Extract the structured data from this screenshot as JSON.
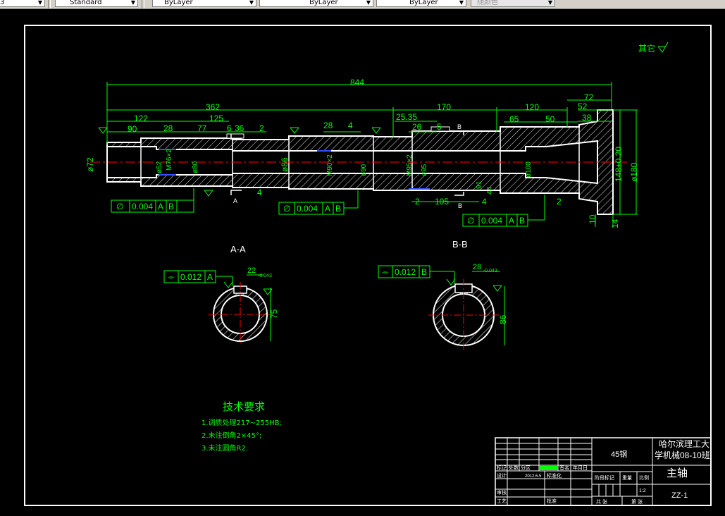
{
  "toolbar": {
    "dim_style": "3",
    "text_style": "Standard",
    "layer": "ByLayer",
    "linetype": "ByLayer",
    "lineweight": "ByLayer",
    "color": "随颜色"
  },
  "drawing": {
    "dims": {
      "d844": "844",
      "d362": "362",
      "d170": "170",
      "d120": "120",
      "d72": "72",
      "d52": "52",
      "d38": "38",
      "d50": "50",
      "d65": "65",
      "d122": "122",
      "d125": "125",
      "d90": "90",
      "d28a": "28",
      "d77": "77",
      "d6": "6",
      "d36": "36",
      "d2a": "2",
      "d28b": "28",
      "d4a": "4",
      "d2535": "25.35",
      "d26": "26",
      "d5": "5",
      "d105": "105",
      "d4b": "4",
      "d2b": "2",
      "d2c": "2",
      "d10": "10",
      "d14": "14",
      "d148": "148±0.20",
      "d180": "ø180",
      "d72dia": "ø72",
      "d86": "ø86",
      "dm76": "M76×2",
      "dm90": "M90×2",
      "dm95": "M95×2",
      "d80": "ø80",
      "d90b": "ø90",
      "d95": "ø95",
      "d100": "ø100",
      "d52dia": "ø52",
      "d44": "44",
      "d91": "91",
      "d4c": "4"
    },
    "fcf": [
      {
        "sym": "∅",
        "val": "0.004",
        "d1": "A",
        "d2": "B"
      },
      {
        "sym": "∅",
        "val": "0.004",
        "d1": "A",
        "d2": "B"
      },
      {
        "sym": "∅",
        "val": "0.004",
        "d1": "A",
        "d2": "B"
      }
    ],
    "sections": {
      "aa": {
        "title": "A-A",
        "fcf_val": "0.012",
        "fcf_datum": "A",
        "key": "22",
        "key_tol": "-0.043",
        "depth": "75"
      },
      "bb": {
        "title": "B-B",
        "fcf_val": "0.012",
        "fcf_datum": "B",
        "key": "28",
        "key_tol": "-0.043",
        "depth": "86"
      }
    },
    "datum_a": "A",
    "datum_b": "B",
    "surface_note": "其它",
    "tech": {
      "title": "技术要求",
      "items": [
        "1.调质处理217~255HB;",
        "2.未注倒角2×45°;",
        "3.未注圆角R2."
      ]
    },
    "title_block": {
      "material": "45钢",
      "school_line1": "哈尔滨理工大",
      "school_line2": "学机械08-10班",
      "part_name": "主轴",
      "drawing_no": "ZZ-1",
      "scale": "1:2",
      "stage_label": "阶段标记",
      "weight_label": "重量",
      "ratio_label": "比例",
      "design_label": "设计",
      "check_label": "审核",
      "process_label": "工艺",
      "approve_label": "批准",
      "sheets_label": "共  张",
      "sheet_label": "第  张",
      "date": "2012.6.5",
      "mark_label": "标记",
      "count_label": "处数",
      "zone_label": "分区",
      "sign_label": "签名",
      "ymd_label": "年月日",
      "std_label": "标准化"
    }
  }
}
